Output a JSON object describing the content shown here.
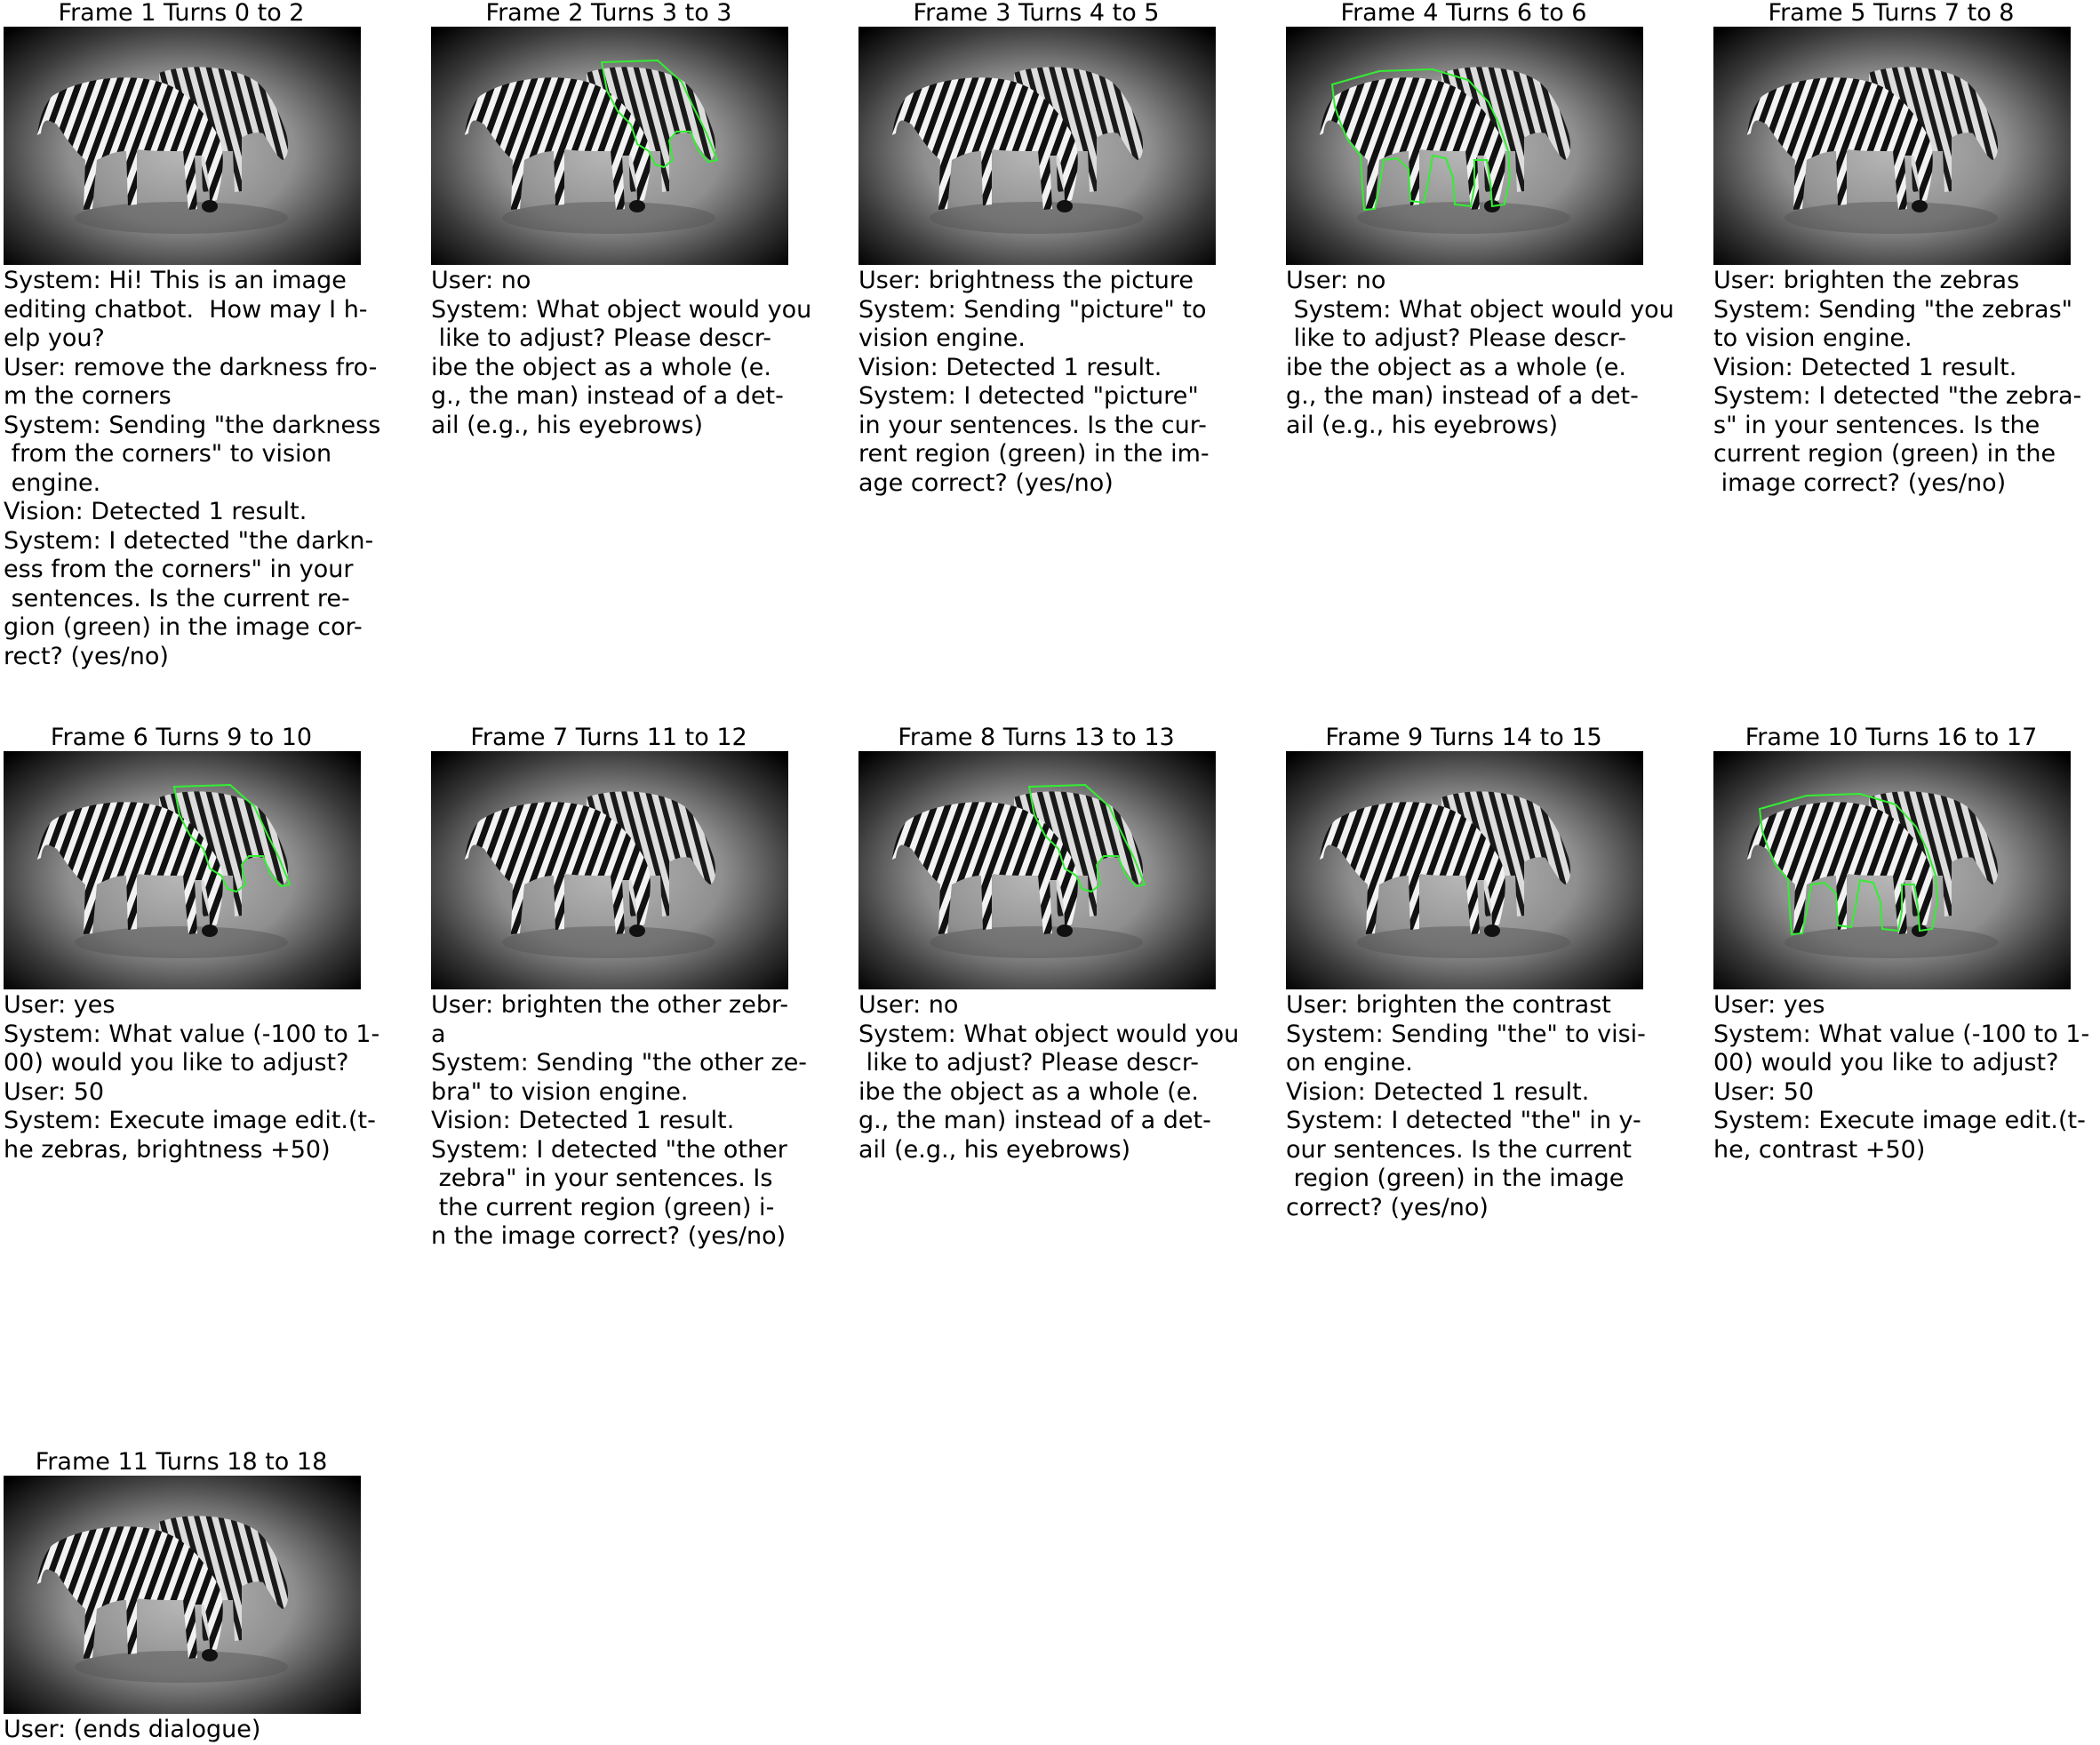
{
  "frames": [
    {
      "title": "Frame 1 Turns 0 to 2",
      "mask": "none",
      "lines": [
        "System: Hi! This is an image",
        "editing chatbot.  How may I h-",
        "elp you?",
        "User: remove the darkness fro-",
        "m the corners",
        "System: Sending \"the darkness",
        " from the corners\" to vision",
        " engine.",
        "Vision: Detected 1 result.",
        "System: I detected \"the darkn-",
        "ess from the corners\" in your",
        " sentences. Is the current re-",
        "gion (green) in the image cor-",
        "rect? (yes/no)"
      ]
    },
    {
      "title": "Frame 2 Turns 3 to 3",
      "mask": "back-zebra",
      "lines": [
        "User: no",
        "System: What object would you",
        " like to adjust? Please descr-",
        "ibe the object as a whole (e.",
        "g., the man) instead of a det-",
        "ail (e.g., his eyebrows)"
      ]
    },
    {
      "title": "Frame 3 Turns 4 to 5",
      "mask": "none",
      "lines": [
        "User: brightness the picture",
        "System: Sending \"picture\" to",
        "vision engine.",
        "Vision: Detected 1 result.",
        "System: I detected \"picture\"",
        "in your sentences. Is the cur-",
        "rent region (green) in the im-",
        "age correct? (yes/no)"
      ]
    },
    {
      "title": "Frame 4 Turns 6 to 6",
      "mask": "front-zebra",
      "lines": [
        "User: no",
        " System: What object would you",
        " like to adjust? Please descr-",
        "ibe the object as a whole (e.",
        "g., the man) instead of a det-",
        "ail (e.g., his eyebrows)"
      ]
    },
    {
      "title": "Frame 5 Turns 7 to 8",
      "mask": "none",
      "lines": [
        "User: brighten the zebras",
        "System: Sending \"the zebras\"",
        "to vision engine.",
        "Vision: Detected 1 result.",
        "System: I detected \"the zebra-",
        "s\" in your sentences. Is the",
        "current region (green) in the",
        " image correct? (yes/no)"
      ]
    },
    {
      "title": "Frame 6 Turns 9 to 10",
      "mask": "back-zebra",
      "lines": [
        "User: yes",
        "System: What value (-100 to 1-",
        "00) would you like to adjust?",
        "User: 50",
        "System: Execute image edit.(t-",
        "he zebras, brightness +50)"
      ]
    },
    {
      "title": "Frame 7 Turns 11 to 12",
      "mask": "none",
      "lines": [
        "User: brighten the other zebr-",
        "a",
        "System: Sending \"the other ze-",
        "bra\" to vision engine.",
        "Vision: Detected 1 result.",
        "System: I detected \"the other",
        " zebra\" in your sentences. Is",
        " the current region (green) i-",
        "n the image correct? (yes/no)"
      ]
    },
    {
      "title": "Frame 8 Turns 13 to 13",
      "mask": "back-zebra",
      "lines": [
        "User: no",
        "System: What object would you",
        " like to adjust? Please descr-",
        "ibe the object as a whole (e.",
        "g., the man) instead of a det-",
        "ail (e.g., his eyebrows)"
      ]
    },
    {
      "title": "Frame 9 Turns 14 to 15",
      "mask": "none",
      "lines": [
        "User: brighten the contrast",
        "System: Sending \"the\" to visi-",
        "on engine.",
        "Vision: Detected 1 result.",
        "System: I detected \"the\" in y-",
        "our sentences. Is the current",
        " region (green) in the image",
        "correct? (yes/no)"
      ]
    },
    {
      "title": "Frame 10 Turns 16 to 17",
      "mask": "front-zebra",
      "lines": [
        "User: yes",
        "System: What value (-100 to 1-",
        "00) would you like to adjust?",
        "User: 50",
        "System: Execute image edit.(t-",
        "he, contrast +50)"
      ]
    },
    {
      "title": "Frame 11 Turns 18 to 18",
      "mask": "none",
      "lines": [
        "User: (ends dialogue)"
      ]
    }
  ],
  "colors": {
    "mask_outline": "#33ee33",
    "background": "#ffffff"
  }
}
